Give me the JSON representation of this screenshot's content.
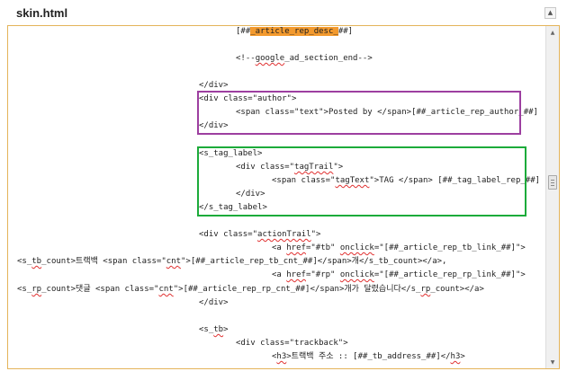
{
  "panel": {
    "title": "skin.html",
    "collapse_icon": "▲"
  },
  "scrollbar": {
    "up_arrow": "▲",
    "down_arrow": "▼",
    "position_fraction": 0.45
  },
  "highlight_color": "#f39a2e",
  "annotation_colors": {
    "purple": "#9d3fa0",
    "green": "#1cab3a"
  },
  "code_lines": [
    {
      "segs": [
        {
          "t": "[##"
        },
        {
          "t": "_article_rep_desc_",
          "hl": true
        },
        {
          "t": "##]"
        }
      ]
    },
    {
      "segs": [
        {
          "t": "<!--"
        },
        {
          "t": "google",
          "sq": true
        },
        {
          "t": "_ad_section_end-->"
        }
      ]
    },
    {
      "segs": [
        {
          "t": "</div>"
        }
      ]
    },
    {
      "segs": [
        {
          "t": "<div class=\"author\">"
        }
      ]
    },
    {
      "segs": [
        {
          "t": "<span class=\"text\">Posted by </span>[##_article_rep_author_##]"
        }
      ]
    },
    {
      "segs": [
        {
          "t": "</div>"
        }
      ]
    },
    {
      "segs": [
        {
          "t": "<s_tag_label>"
        }
      ]
    },
    {
      "segs": [
        {
          "t": "<div class=\""
        },
        {
          "t": "tagTrail",
          "sq": true
        },
        {
          "t": "\">"
        }
      ]
    },
    {
      "segs": [
        {
          "t": "<span class=\""
        },
        {
          "t": "tagText",
          "sq": true
        },
        {
          "t": "\">TAG </span> [##_tag_label_rep_##]"
        }
      ]
    },
    {
      "segs": [
        {
          "t": "</div>"
        }
      ]
    },
    {
      "segs": [
        {
          "t": "</s_tag_label>"
        }
      ]
    },
    {
      "segs": [
        {
          "t": "<div class=\""
        },
        {
          "t": "actionTrail",
          "sq": true
        },
        {
          "t": "\">"
        }
      ]
    },
    {
      "segs": [
        {
          "t": "<a "
        },
        {
          "t": "href",
          "sq": true
        },
        {
          "t": "=\"#tb\" "
        },
        {
          "t": "onclick",
          "sq": true
        },
        {
          "t": "=\"[##_article_rep_tb_link_##]\">"
        }
      ]
    },
    {
      "segs": [
        {
          "t": "<s_"
        },
        {
          "t": "tb",
          "sq": true
        },
        {
          "t": "_count>트랙백 <span class=\""
        },
        {
          "t": "cnt",
          "sq": true
        },
        {
          "t": "\">[##_article_rep_tb_cnt_##]</span>개</s_tb_count></a>,"
        }
      ]
    },
    {
      "segs": [
        {
          "t": "<a "
        },
        {
          "t": "href",
          "sq": true
        },
        {
          "t": "=\"#rp\" "
        },
        {
          "t": "onclick",
          "sq": true
        },
        {
          "t": "=\"[##_article_rep_rp_link_##]\">"
        }
      ]
    },
    {
      "segs": [
        {
          "t": "<s_"
        },
        {
          "t": "rp",
          "sq": true
        },
        {
          "t": "_count>댓글 <span class=\""
        },
        {
          "t": "cnt",
          "sq": true
        },
        {
          "t": "\">[##_article_rep_rp_cnt_##]</span>개가 달렸습니다</s_"
        },
        {
          "t": "rp",
          "sq": true
        },
        {
          "t": "_count></a>"
        }
      ]
    },
    {
      "segs": [
        {
          "t": "</div>"
        }
      ]
    },
    {
      "segs": [
        {
          "t": "<s_"
        },
        {
          "t": "tb",
          "sq": true
        },
        {
          "t": ">"
        }
      ]
    },
    {
      "segs": [
        {
          "t": "<div class=\"trackback\">"
        }
      ]
    },
    {
      "segs": [
        {
          "t": "<"
        },
        {
          "t": "h3",
          "sq": true
        },
        {
          "t": ">트랙백 주소 :: [##_tb_address_##]</"
        },
        {
          "t": "h3",
          "sq": true
        },
        {
          "t": ">"
        }
      ]
    }
  ]
}
